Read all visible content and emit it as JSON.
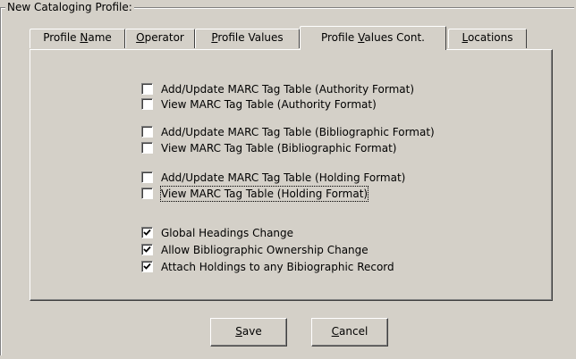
{
  "group": {
    "title": "New Cataloging Profile:"
  },
  "tabs": [
    {
      "pre": "Profile ",
      "ul": "N",
      "post": "ame"
    },
    {
      "pre": "",
      "ul": "O",
      "post": "perator"
    },
    {
      "pre": "",
      "ul": "P",
      "post": "rofile Values"
    },
    {
      "pre": "Profile ",
      "ul": "V",
      "post": "alues Cont."
    },
    {
      "pre": "",
      "ul": "L",
      "post": "ocations"
    }
  ],
  "active_tab_index": 3,
  "checkboxes": [
    {
      "label": "Add/Update MARC Tag Table (Authority Format)",
      "checked": false
    },
    {
      "label": "View MARC Tag Table (Authority Format)",
      "checked": false
    },
    {
      "label": "Add/Update MARC Tag Table (Bibliographic Format)",
      "checked": false
    },
    {
      "label": "View MARC Tag Table (Bibliographic Format)",
      "checked": false
    },
    {
      "label": "Add/Update MARC Tag Table (Holding Format)",
      "checked": false
    },
    {
      "label": "View MARC Tag Table (Holding Format)",
      "checked": false
    },
    {
      "label": "Global Headings Change",
      "checked": true
    },
    {
      "label": "Allow Bibliographic Ownership Change",
      "checked": true
    },
    {
      "label": "Attach Holdings to any Bibiographic Record",
      "checked": true
    }
  ],
  "buttons": {
    "save": {
      "ul": "S",
      "post": "ave"
    },
    "cancel": {
      "ul": "C",
      "post": "ancel"
    }
  }
}
